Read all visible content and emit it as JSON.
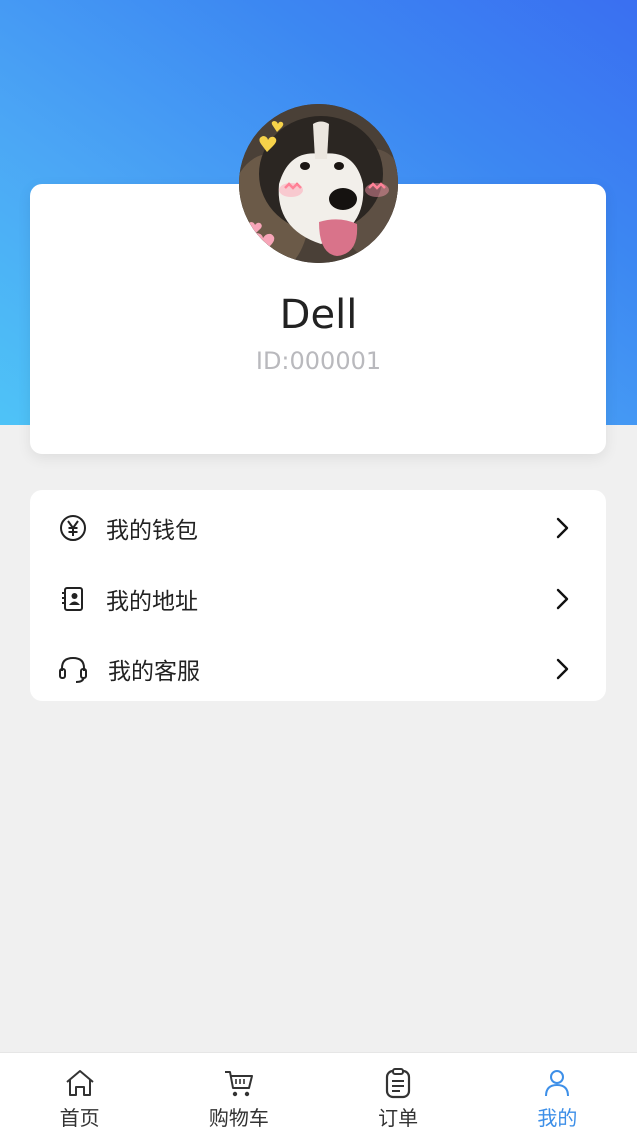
{
  "profile": {
    "name": "Dell",
    "id_text": "ID:000001"
  },
  "menu": {
    "items": [
      {
        "label": "我的钱包",
        "icon": "yen-coin-icon"
      },
      {
        "label": "我的地址",
        "icon": "address-book-icon"
      },
      {
        "label": "我的客服",
        "icon": "headset-icon"
      }
    ]
  },
  "tabbar": {
    "tabs": [
      {
        "label": "首页",
        "icon": "home-icon",
        "active": false
      },
      {
        "label": "购物车",
        "icon": "cart-icon",
        "active": false
      },
      {
        "label": "订单",
        "icon": "clipboard-icon",
        "active": false
      },
      {
        "label": "我的",
        "icon": "user-icon",
        "active": true
      }
    ]
  },
  "colors": {
    "gradient_start": "#4ec3f7",
    "gradient_end": "#3a6ff1",
    "accent": "#3d8fe8",
    "background": "#f0f0f0"
  }
}
